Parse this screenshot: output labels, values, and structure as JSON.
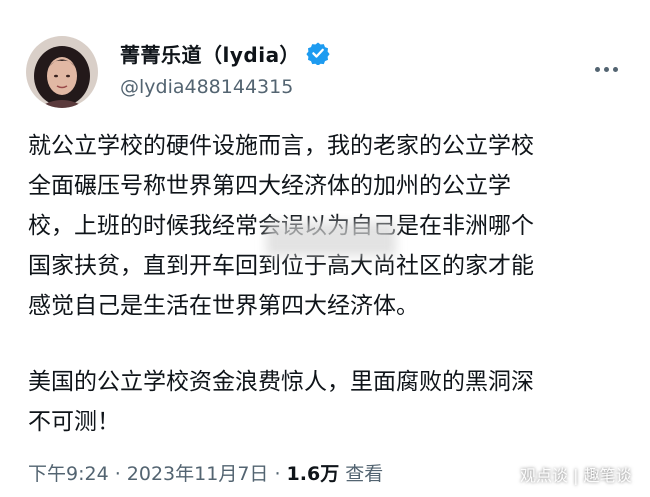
{
  "author": {
    "display_name": "菁菁乐道（lydia）",
    "handle": "@lydia488144315",
    "verified_icon": "verified-badge-icon",
    "avatar_icon": "avatar"
  },
  "menu": {
    "icon": "more-icon"
  },
  "tweet": {
    "lines": [
      "就公立学校的硬件设施而言，我的老家的公立学校",
      "全面碾压号称世界第四大经济体的加州的公立学",
      "校，上班的时候我经常会误以为自己是在非洲哪个",
      "国家扶贫，直到开车回到位于高大尚社区的家才能",
      "感觉自己是生活在世界第四大经济体。",
      "美国的公立学校资金浪费惊人，里面腐败的黑洞深",
      "不可测！"
    ]
  },
  "meta": {
    "timestamp": "下午9:24 · 2023年11月7日 ·",
    "views": "1.6万",
    "views_label": "查看"
  },
  "watermark": "观点谈 | 趣笔谈",
  "colors": {
    "text": "#0f1419",
    "secondary": "#536471",
    "verified": "#1d9bf0"
  }
}
